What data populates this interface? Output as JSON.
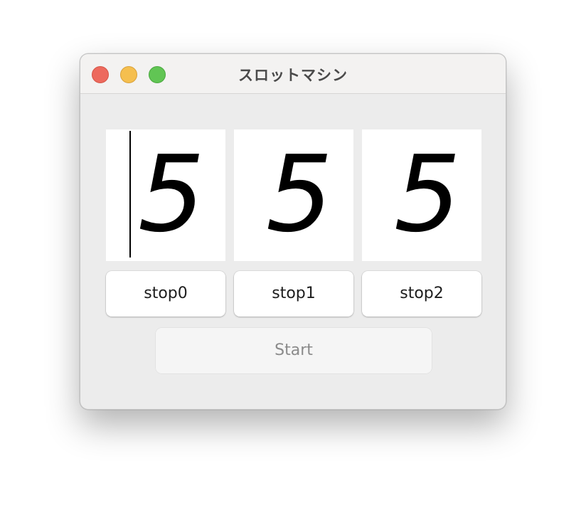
{
  "window": {
    "title": "スロットマシン"
  },
  "reels": [
    {
      "value": "5"
    },
    {
      "value": "5"
    },
    {
      "value": "5"
    }
  ],
  "buttons": {
    "stop0": "stop0",
    "stop1": "stop1",
    "stop2": "stop2",
    "start": "Start"
  },
  "colors": {
    "close": "#ed6a5e",
    "minimize": "#f5bf4f",
    "zoom": "#61c554",
    "window_bg": "#ececec",
    "reel_bg": "#ffffff",
    "start_disabled_text": "#8a8a8a"
  },
  "icons": {
    "close": "close-icon",
    "minimize": "minimize-icon",
    "zoom": "zoom-icon"
  }
}
